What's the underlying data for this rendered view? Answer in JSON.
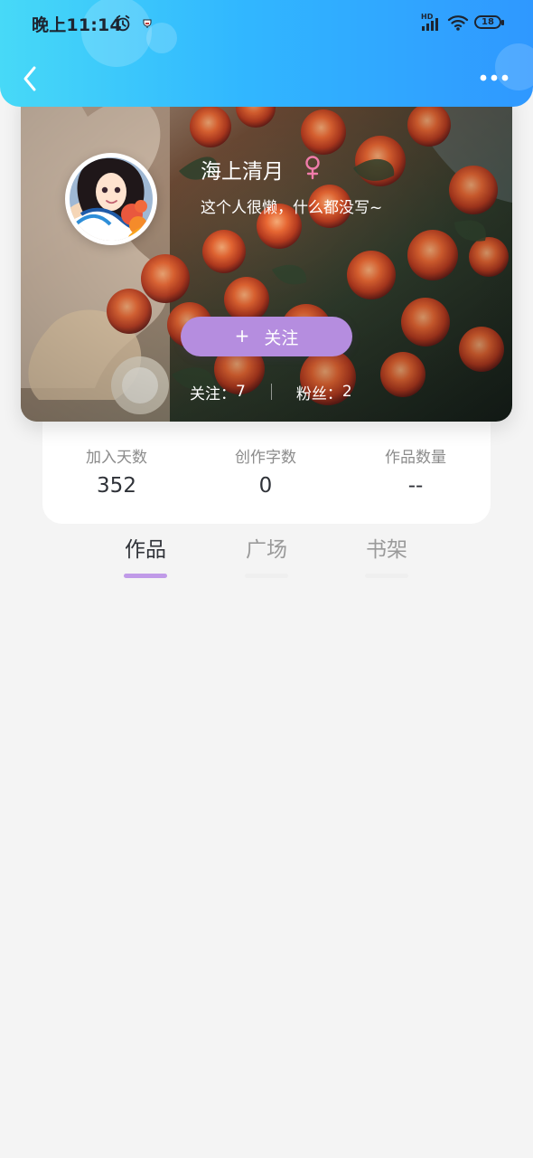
{
  "status_bar": {
    "time": "晚上11:14",
    "network_badge": "HD",
    "battery": "18",
    "icons": [
      "alarm-icon",
      "app-notification-icon",
      "signal-icon",
      "wifi-icon",
      "battery-icon"
    ]
  },
  "header": {
    "back_icon": "back-chevron-icon",
    "more_icon": "more-dots-icon"
  },
  "profile": {
    "name": "海上清月",
    "gender_icon": "female-icon",
    "bio": "这个人很懒，什么都没写~",
    "follow_button": "关注",
    "follow_plus": "+",
    "following_label": "关注：",
    "following_count": "7",
    "fans_label": "粉丝：",
    "fans_count": "2"
  },
  "stats": [
    {
      "label": "加入天数",
      "value": "352"
    },
    {
      "label": "创作字数",
      "value": "0"
    },
    {
      "label": "作品数量",
      "value": "--"
    }
  ],
  "tabs": [
    {
      "label": "作品",
      "active": true
    },
    {
      "label": "广场",
      "active": false
    },
    {
      "label": "书架",
      "active": false
    }
  ],
  "colors": {
    "header_gradient_start": "#47d9f7",
    "header_gradient_end": "#2f98ff",
    "accent_purple": "#b58ddf",
    "active_tab_indicator": "#c09ae8",
    "page_background": "#f4f4f4"
  }
}
